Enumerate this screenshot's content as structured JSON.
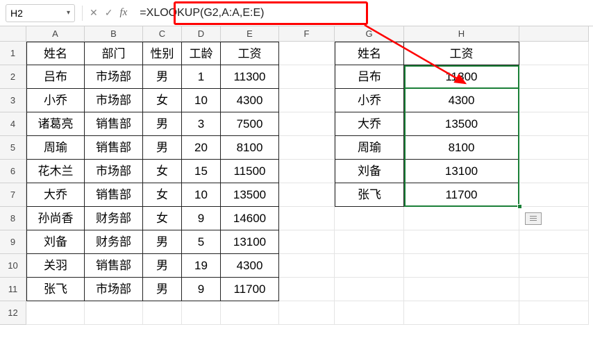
{
  "nameBox": "H2",
  "formula": "=XLOOKUP(G2,A:A,E:E)",
  "columns": [
    "A",
    "B",
    "C",
    "D",
    "E",
    "F",
    "G",
    "H"
  ],
  "rowNumbers": [
    "1",
    "2",
    "3",
    "4",
    "5",
    "6",
    "7",
    "8",
    "9",
    "10",
    "11",
    "12"
  ],
  "leftTable": {
    "headers": {
      "A": "姓名",
      "B": "部门",
      "C": "性别",
      "D": "工龄",
      "E": "工资"
    },
    "rows": [
      {
        "A": "吕布",
        "B": "市场部",
        "C": "男",
        "D": "1",
        "E": "11300"
      },
      {
        "A": "小乔",
        "B": "市场部",
        "C": "女",
        "D": "10",
        "E": "4300"
      },
      {
        "A": "诸葛亮",
        "B": "销售部",
        "C": "男",
        "D": "3",
        "E": "7500"
      },
      {
        "A": "周瑜",
        "B": "销售部",
        "C": "男",
        "D": "20",
        "E": "8100"
      },
      {
        "A": "花木兰",
        "B": "市场部",
        "C": "女",
        "D": "15",
        "E": "11500"
      },
      {
        "A": "大乔",
        "B": "销售部",
        "C": "女",
        "D": "10",
        "E": "13500"
      },
      {
        "A": "孙尚香",
        "B": "财务部",
        "C": "女",
        "D": "9",
        "E": "14600"
      },
      {
        "A": "刘备",
        "B": "财务部",
        "C": "男",
        "D": "5",
        "E": "13100"
      },
      {
        "A": "关羽",
        "B": "销售部",
        "C": "男",
        "D": "19",
        "E": "4300"
      },
      {
        "A": "张飞",
        "B": "市场部",
        "C": "男",
        "D": "9",
        "E": "11700"
      }
    ]
  },
  "rightTable": {
    "headers": {
      "G": "姓名",
      "H": "工资"
    },
    "rows": [
      {
        "G": "吕布",
        "H": "11300"
      },
      {
        "G": "小乔",
        "H": "4300"
      },
      {
        "G": "大乔",
        "H": "13500"
      },
      {
        "G": "周瑜",
        "H": "8100"
      },
      {
        "G": "刘备",
        "H": "13100"
      },
      {
        "G": "张飞",
        "H": "11700"
      }
    ]
  }
}
